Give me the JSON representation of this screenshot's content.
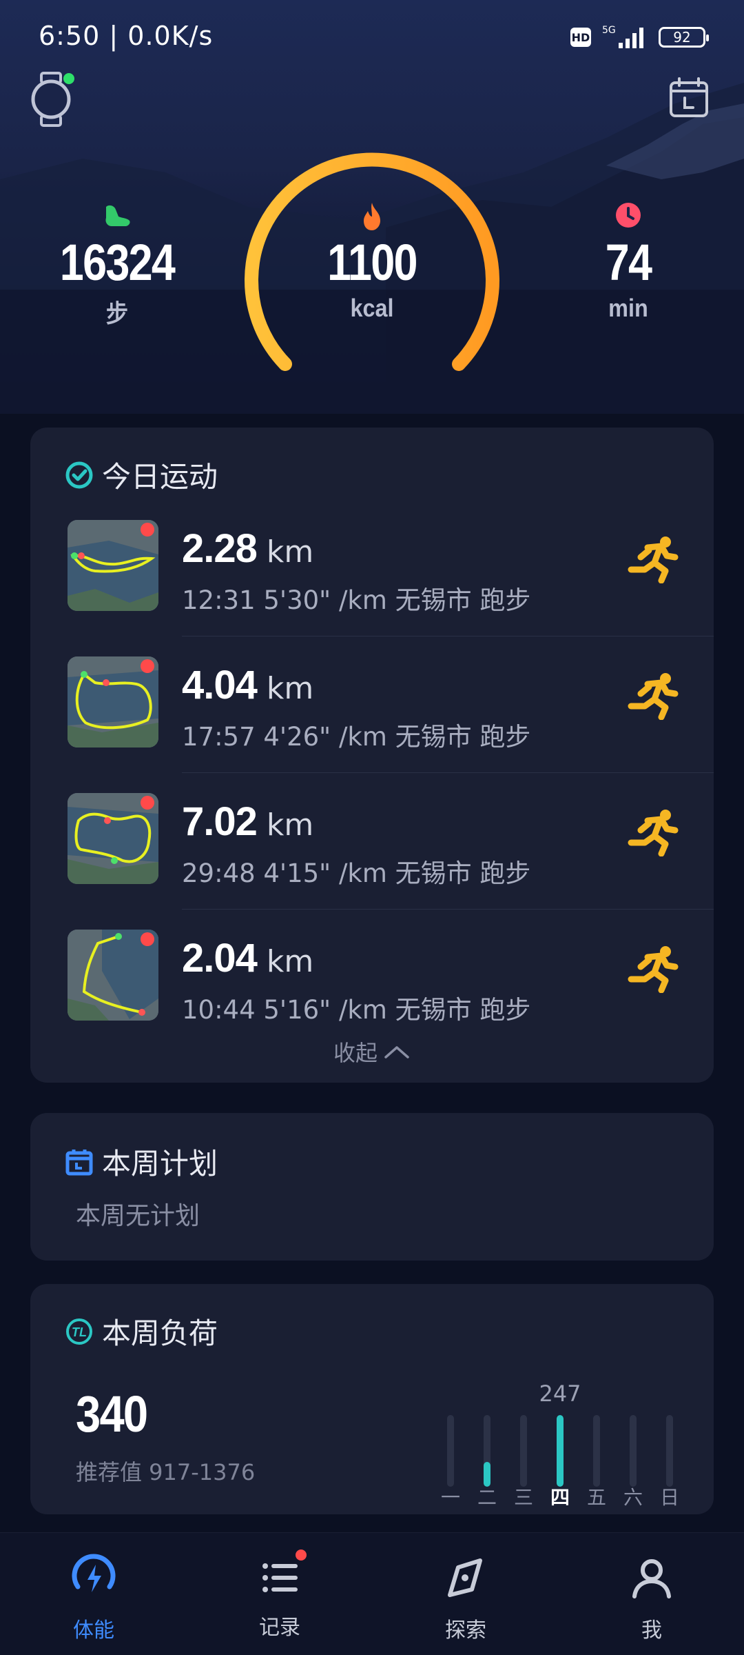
{
  "status_bar": {
    "time": "6:50 | 0.0K/s",
    "hd": "HD",
    "network": "5G",
    "battery": "92"
  },
  "summary": {
    "steps_value": "16324",
    "steps_unit": "步",
    "calories_value": "1100",
    "calories_unit": "kcal",
    "minutes_value": "74",
    "minutes_unit": "min",
    "calories_progress": 0.9
  },
  "today": {
    "title": "今日运动",
    "activities": [
      {
        "distance": "2.28",
        "unit": "km",
        "meta": "12:31  5'30\" /km  无锡市 跑步"
      },
      {
        "distance": "4.04",
        "unit": "km",
        "meta": "17:57  4'26\" /km  无锡市 跑步"
      },
      {
        "distance": "7.02",
        "unit": "km",
        "meta": "29:48  4'15\" /km  无锡市 跑步"
      },
      {
        "distance": "2.04",
        "unit": "km",
        "meta": "10:44  5'16\" /km  无锡市 跑步"
      }
    ],
    "collapse_label": "收起"
  },
  "plan": {
    "title": "本周计划",
    "empty_text": "本周无计划"
  },
  "load": {
    "title": "本周负荷",
    "value": "340",
    "recommended": "推荐值 917-1376",
    "highlight_value": "247",
    "days": [
      "一",
      "二",
      "三",
      "四",
      "五",
      "六",
      "日"
    ],
    "levels": [
      0,
      0.35,
      0,
      1.0,
      0,
      0,
      0
    ],
    "active_day_index": 3
  },
  "nav": {
    "items": [
      {
        "label": "体能",
        "icon": "energy-icon"
      },
      {
        "label": "记录",
        "icon": "list-icon"
      },
      {
        "label": "探索",
        "icon": "compass-icon"
      },
      {
        "label": "我",
        "icon": "user-icon"
      }
    ],
    "active_index": 0
  },
  "colors": {
    "accent": "#3f8cff",
    "gauge": "#ffb52e",
    "teal": "#2bc7c4",
    "run": "#f5b623"
  }
}
